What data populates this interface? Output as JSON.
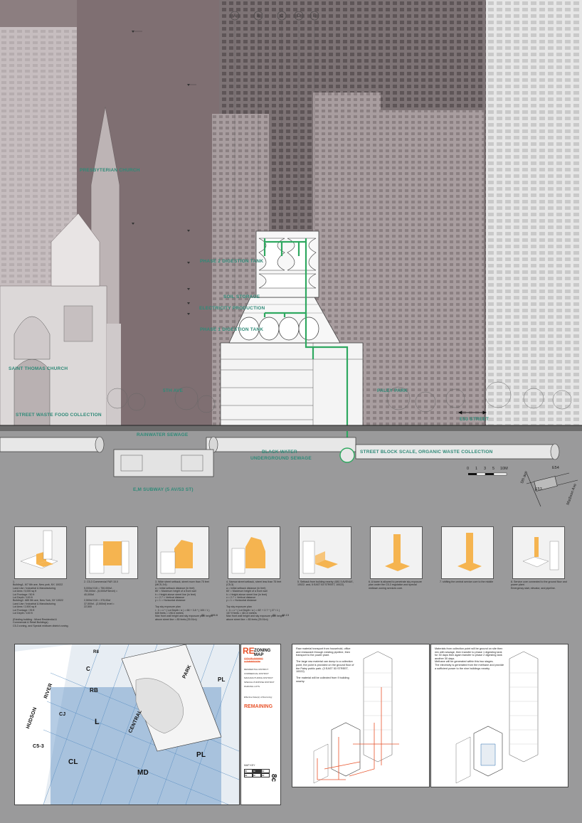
{
  "section": {
    "gridlines": [
      "A",
      "B",
      "C",
      "D",
      "E"
    ],
    "labels": {
      "presbyterian_church": "PRESBYTERIAN CHURCH",
      "saint_thomas_church": "SAINT THOMAS CHURCH",
      "street_waste_food": "STREET WASTE FOOD COLLECTION",
      "fifth_ave": "5TH AVE",
      "phase2_tank": "PHASE 2 DIGESTION TANK",
      "soil_storage": "SOIL STORAGE",
      "electricity": "ELECTRICITY PRODUCTION",
      "phase1_tank": "PHASE 1 DIGESTION TANK",
      "paley_park": "PALEY PARK",
      "e53_street": "E53 STREET",
      "rainwater_sewage": "RAINWATER SEWAGE",
      "black_water": "BLACK WATER",
      "underground_sewage": "UNDERGROUND SEWAGE",
      "street_block": "STREET BLOCK SCALE, ORGANIC WASTE COLLECTION",
      "subway": "E,M SUBWAY (5 AV/53 ST)"
    },
    "scale_ticks": [
      "0",
      "1",
      "3",
      "5",
      "10M"
    ],
    "keymap": {
      "fifth": "5th ave",
      "e54": "E54",
      "e53": "E53",
      "madison": "Madison Ave"
    }
  },
  "colors": {
    "pipe": "#2fa860",
    "mass": "#f5b450",
    "teal": "#2f8a78",
    "accent_red": "#e8542c",
    "map_blue": "#2a6fb0"
  },
  "steps": [
    {
      "text": "1.\nBuilding1- 6/7 6th ave, New york, NY, 10022\nLand Use / Industrial & Manufacturing\nLot Area / 5,000 sq ft\nLot Frontage / 50 ft\nLot Depth / 100 ft\nBuilding2- 685 5th ave, New York, NY 10022\nLand Use / Industrial & Manufacturing\nLot Area / 2,500 sq ft\nLot Frontage / 25 ft\nLot Depth / 100 ft\n\n(Existing building : Mixed Residential & Commercial & Retail Buildings)\nC5-3 zoning, and Special midtown district zoning."
    },
    {
      "text": "2. C5-3 Commercial FAR 15.0\n\n5,000sf X15 = 750,000sf ,\n750,000sf - (5,000sf*3level) =\n40,000sf\n\n2,500sf X15 = 375,00sf\n37,500sf - (2,500sf) level =\n22,500"
    },
    {
      "text": "3. Wide street setback, street more than 75 feet (MCS-3:6)\na = Initial setback distance (in feet)\n85' = Maximum height of a front wall\nh = Height above street line (in feet)\nx = 2.7 = Vertical distance\ny = 1 = Horizontal distance\n\nTop sky exposure plan\nr : h = x * ( Lot Depth / a ) = 66 + 3.8 * ( 100 / 1 )\n645 feets = 196.6 meters\nMax front wall height and sky exposure plan height above street line = 85 feets (25.91m)"
    },
    {
      "text": "4. Narrow street setback, street less than 75 feet (C5-3)\na = Initial setback distance (in feet)\n60' = Maximum height of a front wall\nh = Height above street line (in feet)\nx = 2.7 = Vertical distance\ny = 1 = Horizontal distance\n\nTop sky exposure plan\nr : h = x * ( Lot Depth / a ) = 60' + 2.7 * ( 27 / 1 )\n157.9 feets = 48.13 meters\nMax front wall height and sky exposure plan height above street line = 85 feets (25.91m)"
    },
    {
      "text": "5. Setback from building nearby. (681 5 AVENUE, 10022. and, 5 EAST 53 STREET, 10022)"
    },
    {
      "text": "6. A tower is allowed to penetrate sky exposure plan under the C5-3 regulation and special midtown zoning services core."
    },
    {
      "text": "7. shifting the central service core to the middle"
    },
    {
      "text": "8. Service core connected to the ground floor and power plant.\nEmergency stair, elevator, and pipeline."
    }
  ],
  "step_dims": {
    "d3a": "25",
    "d3b": "196.6",
    "d4a": "25",
    "d4b": "48.13"
  },
  "zoning_map": {
    "prefix": "RE",
    "title": "ZONING MAP",
    "strike": "CITY PLANNING COMMISSION",
    "legend": [
      "RESIDENTIAL DISTRICT",
      "COMMERCIAL DISTRICT",
      "MANUFACTURING DISTRICT",
      "SPECIAL PURPOSE DISTRICT",
      "PARKING LOTS"
    ],
    "effective": "Effective Date(s) of Rezoning:",
    "remaining": "REMAINING",
    "map_key": "MAP KEY",
    "sheet_no": "8c",
    "key_cells": [
      "8b",
      "8c",
      "8d",
      "8a",
      "9c",
      "9d"
    ],
    "districts": [
      {
        "id": "rb",
        "label": "RB"
      },
      {
        "id": "l",
        "label": "L"
      },
      {
        "id": "cl",
        "label": "CL"
      },
      {
        "id": "md",
        "label": "MD"
      },
      {
        "id": "pl1",
        "label": "PL"
      },
      {
        "id": "pl2",
        "label": "PL"
      },
      {
        "id": "c",
        "label": "C"
      },
      {
        "id": "cj",
        "label": "CJ"
      },
      {
        "id": "cs",
        "label": "C5-3"
      },
      {
        "id": "r8",
        "label": "R8"
      }
    ],
    "streets": {
      "hudson": "HUDSON",
      "river": "RIVER",
      "central": "CENTRAL",
      "park": "PARK"
    }
  },
  "diagram_notes": {
    "left": "Raw material transport from household, office and restaurant through existing pipeline, then transport to the power plant.\n\nThe large raw material can dump to a collection point, the point is provided on the ground floor of the Paley public park. (3 EAST 53 STREET, 10022)\n\nThe material will be collected from 9 building nearby.",
    "right": "Materials from collection point will be ground on site then mix with sewage, then transfer to phase 1 digesting tank for 30 days then again transfer to phase 2 digesting tank another 30 days.\nMethane will be generated within this two stages.\nThe electricity is generated from the methane and provide a sufficient power to the nine buildings nearby."
  }
}
